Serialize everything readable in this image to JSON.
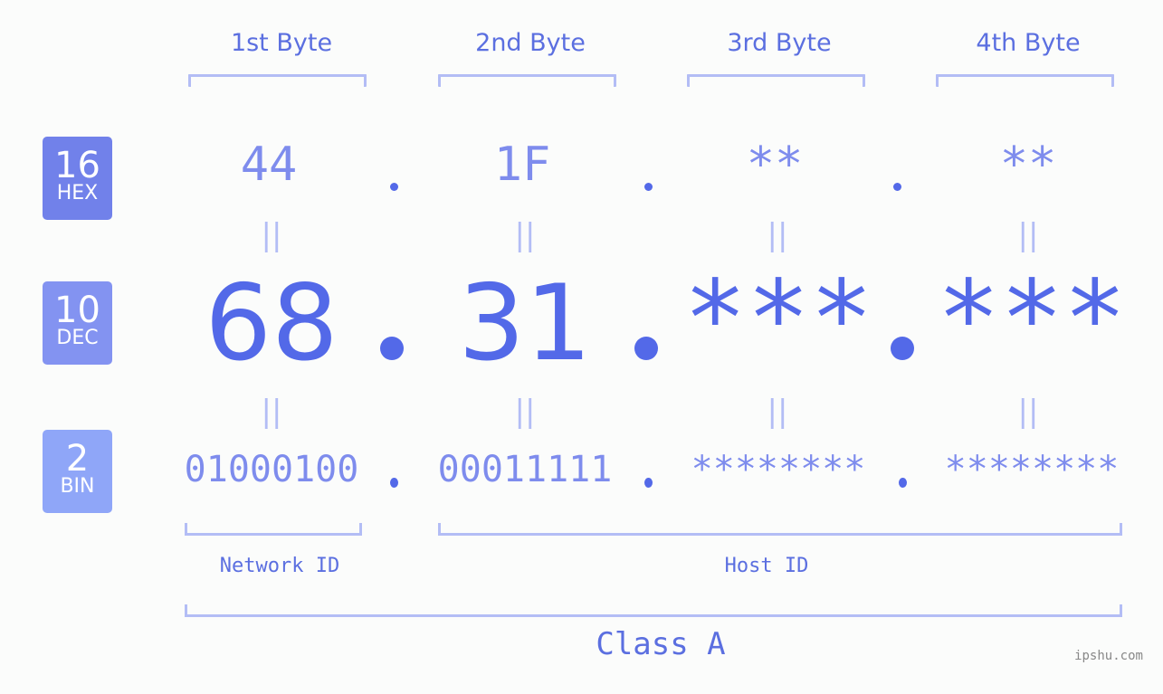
{
  "bytes": [
    {
      "header": "1st Byte",
      "hex": "44",
      "dec": "68",
      "bin": "01000100"
    },
    {
      "header": "2nd Byte",
      "hex": "1F",
      "dec": "31",
      "bin": "00011111"
    },
    {
      "header": "3rd Byte",
      "hex": "**",
      "dec": "***",
      "bin": "********"
    },
    {
      "header": "4th Byte",
      "hex": "**",
      "dec": "***",
      "bin": "********"
    }
  ],
  "badges": {
    "hex": {
      "number": "16",
      "label": "HEX",
      "color": "#7181ea"
    },
    "dec": {
      "number": "10",
      "label": "DEC",
      "color": "#8393f1"
    },
    "bin": {
      "number": "2",
      "label": "BIN",
      "color": "#8fa6f8"
    }
  },
  "equals_symbol": "||",
  "network_label": "Network ID",
  "host_label": "Host ID",
  "class_label": "Class A",
  "watermark": "ipshu.com",
  "colors": {
    "accent": "#5369e8",
    "light": "#b3bdf5",
    "mid": "#7e8ced"
  }
}
